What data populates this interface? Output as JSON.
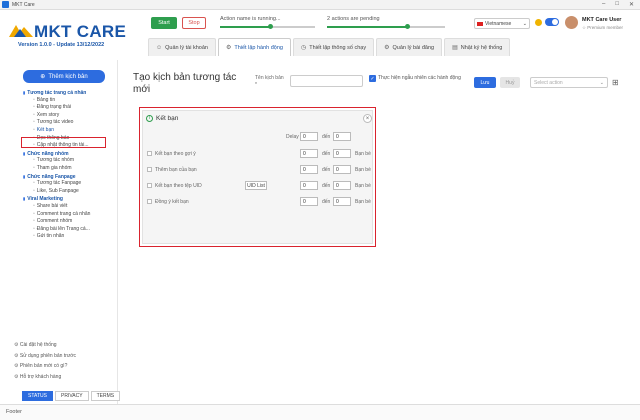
{
  "window": {
    "title": "MKT Care"
  },
  "brand": {
    "name": "MKT CARE",
    "version": "Version 1.0.0 - Update 13/12/2022"
  },
  "controls": {
    "start": "Start",
    "stop": "Stop",
    "running": "Action name is running...",
    "pending": "2 actions are pending"
  },
  "language": {
    "selected": "Vietnamese"
  },
  "user": {
    "name": "MKT Care User",
    "tier": "☆ Premium member"
  },
  "tabs": [
    {
      "label": "Quản lý tài khoản",
      "icon": "user-icon"
    },
    {
      "label": "Thiết lập hành động",
      "icon": "gear-icon"
    },
    {
      "label": "Thiết lập thông số chạy",
      "icon": "clock-icon"
    },
    {
      "label": "Quản lý bài đăng",
      "icon": "gear-icon"
    },
    {
      "label": "Nhật ký hệ thống",
      "icon": "log-icon"
    }
  ],
  "sidebar": {
    "add_button": "Thêm kịch bản",
    "groups": [
      {
        "title": "Tương tác trang cá nhân",
        "items": [
          "Bảng tin",
          "Đăng trạng thái",
          "Xem story",
          "Tương tác video",
          "Kết bạn",
          "Đọc thông báo",
          "Cập nhật thông tin tài..."
        ]
      },
      {
        "title": "Chức năng nhóm",
        "items": [
          "Tương tác nhóm",
          "Tham gia nhóm"
        ]
      },
      {
        "title": "Chức năng Fanpage",
        "items": [
          "Tương tác Fanpage",
          "Like, Sub Fanpage"
        ]
      },
      {
        "title": "Viral Marketing",
        "items": [
          "Share bài viết",
          "Comment trang cá nhân",
          "Comment nhóm",
          "Đăng bài lên Trang cá...",
          "Gửi tin nhắn"
        ]
      }
    ],
    "footer_links": [
      "Cài đặt hệ thống",
      "Sử dụng phiên bản trước",
      "Phiên bản mới có gì?",
      "Hỗ trợ khách hàng"
    ],
    "footer_tabs": [
      "STATUS",
      "PRIVACY",
      "TERMS"
    ]
  },
  "main": {
    "title": "Tạo kịch bản tương tác mới",
    "script_name_label": "Tên kịch bản *",
    "script_name_value": "",
    "random_label": "Thực hiện ngẫu nhiên các hành động",
    "save": "Lưu",
    "cancel": "Huỷ",
    "select_placeholder": "Select action"
  },
  "panel": {
    "title": "Kết bạn",
    "delay_label": "Delay",
    "delay_from": "0",
    "delay_to": "0",
    "den": "đến",
    "rows": [
      {
        "label": "Kết bạn theo gợi ý",
        "from": "0",
        "to": "0",
        "unit": "Bạn bè"
      },
      {
        "label": "Thêm bạn của bạn",
        "from": "0",
        "to": "0",
        "unit": "Bạn bè"
      },
      {
        "label": "Kết bạn theo tệp UID",
        "button": "UID List",
        "from": "0",
        "to": "0",
        "unit": "Bạn bè"
      },
      {
        "label": "Đồng ý kết bạn",
        "from": "0",
        "to": "0",
        "unit": "Bạn bè"
      }
    ]
  },
  "footer": {
    "text": "Footer"
  },
  "colors": {
    "primary": "#2d6cdf",
    "brand": "#1a56a8",
    "start": "#2e9e4e",
    "highlight": "#d9232e"
  }
}
